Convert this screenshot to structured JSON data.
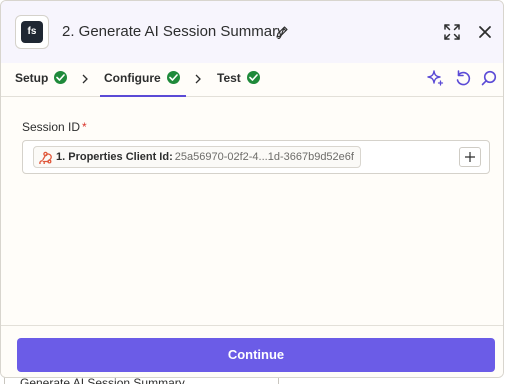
{
  "header": {
    "app_logo_text": "fs",
    "title": "2. Generate AI Session Summary",
    "icons": [
      "pencil-icon",
      "expand-icon",
      "close-icon"
    ]
  },
  "tabs": [
    {
      "label": "Setup",
      "status": "complete",
      "active": false
    },
    {
      "label": "Configure",
      "status": "complete",
      "active": true
    },
    {
      "label": "Test",
      "status": "complete",
      "active": false
    }
  ],
  "toolbar_icons": [
    "ai-sparkle-icon",
    "undo-icon",
    "search-icon"
  ],
  "form": {
    "field_label": "Session ID",
    "required_marker": "*",
    "pill": {
      "icon": "webhook-icon",
      "step": "1. Properties Client Id:",
      "value": "25a56970-02f2-4...1d-3667b9d52e6f"
    },
    "add_icon": "plus-icon"
  },
  "footer": {
    "continue_label": "Continue"
  },
  "background_text": "Generate AI Session Summary",
  "colors": {
    "accent": "#6b5ce7",
    "check_green": "#1f8a3b",
    "required_red": "#d9342b",
    "webhook_orange": "#e0573a"
  }
}
